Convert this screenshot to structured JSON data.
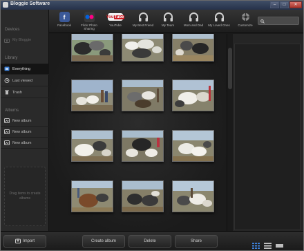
{
  "window": {
    "title": "Bloggie Software"
  },
  "sidebar": {
    "devices_header": "Devices",
    "device_item": "My Bloggie",
    "library_header": "Library",
    "library_items": [
      {
        "label": "Everything",
        "icon": "everything-icon",
        "active": true
      },
      {
        "label": "Last viewed",
        "icon": "clock-icon",
        "active": false
      },
      {
        "label": "Trash",
        "icon": "trash-icon",
        "active": false
      }
    ],
    "albums_header": "Albums",
    "albums": [
      {
        "label": "New album"
      },
      {
        "label": "New album"
      },
      {
        "label": "New album"
      }
    ],
    "drop_hint": "Drag items to create albums"
  },
  "share_bar": {
    "items": [
      {
        "label": "Facebook",
        "icon": "facebook-icon",
        "color": "#3b5998"
      },
      {
        "label": "Flickr Photo Sharing",
        "icon": "flickr-icon",
        "color": "#3a3a3a"
      },
      {
        "label": "YouTube",
        "icon": "youtube-icon",
        "color": "#cc181e"
      },
      {
        "label": "My Best Friend",
        "icon": "headphones-icon",
        "color": "#cfcfcf"
      },
      {
        "label": "My Team",
        "icon": "headphones-icon",
        "color": "#cfcfcf"
      },
      {
        "label": "Mom and Dad",
        "icon": "headphones-icon",
        "color": "#cfcfcf"
      },
      {
        "label": "My Loved Ones",
        "icon": "headphones-icon",
        "color": "#cfcfcf"
      },
      {
        "label": "Customize",
        "icon": "gear-icon",
        "color": "#9a9a9a"
      }
    ]
  },
  "search": {
    "placeholder": "",
    "value": "",
    "icon": "search-icon"
  },
  "photos": [
    {
      "scene": "goats-dark"
    },
    {
      "scene": "goats-white"
    },
    {
      "scene": "goats-dark"
    },
    {
      "scene": "sky-people"
    },
    {
      "scene": "goats-mixed"
    },
    {
      "scene": "goats-white"
    },
    {
      "scene": "goats-white"
    },
    {
      "scene": "goats-dark"
    },
    {
      "scene": "goats-white"
    },
    {
      "scene": "brown-dog"
    },
    {
      "scene": "goats-dark"
    },
    {
      "scene": "goats-mixed"
    }
  ],
  "bottom_bar": {
    "import_label": "Import",
    "create_album_label": "Create album",
    "delete_label": "Delete",
    "share_label": "Share"
  },
  "colors": {
    "accent": "#3d7fd6",
    "background": "#1a1a1a",
    "titlebar": "#2e3a54"
  }
}
